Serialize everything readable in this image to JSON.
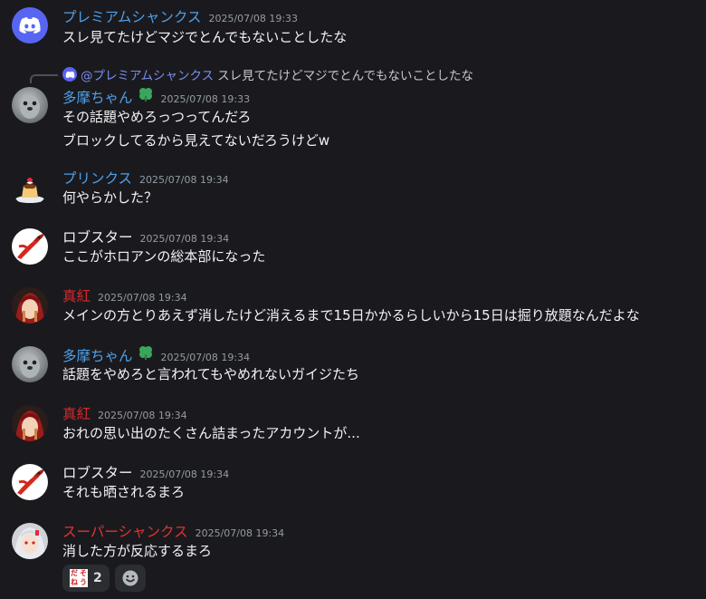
{
  "messages": [
    {
      "author": "プレミアムシャンクス",
      "color": "#4fa0e8",
      "time": "2025/07/08 19:33",
      "lines": [
        "スレ見てたけどマジでとんでもないことしたな"
      ],
      "avatar": "discord-logo"
    },
    {
      "author": "多摩ちゃん",
      "color": "#4fa0e8",
      "time": "2025/07/08 19:33",
      "lines": [
        "その話題やめろっつってんだろ",
        "ブロックしてるから見えてないだろうけどw"
      ],
      "avatar": "seal-photo",
      "badge": "clover"
    },
    {
      "author": "プリンクス",
      "color": "#4fa0e8",
      "time": "2025/07/08 19:34",
      "lines": [
        "何やらかした？"
      ],
      "avatar": "pudding"
    },
    {
      "author": "ロブスター",
      "color": "#f2f3f5",
      "time": "2025/07/08 19:34",
      "lines": [
        "ここがホロアンの総本部になった"
      ],
      "avatar": "lobster"
    },
    {
      "author": "真紅",
      "color": "#d8262a",
      "time": "2025/07/08 19:34",
      "lines": [
        "メインの方とりあえず消したけど消えるまで15日かかるらしいから15日は掘り放題なんだよな"
      ],
      "avatar": "anime-red"
    },
    {
      "author": "多摩ちゃん",
      "color": "#4fa0e8",
      "time": "2025/07/08 19:34",
      "lines": [
        "話題をやめろと言われてもやめれないガイジたち"
      ],
      "avatar": "seal-photo",
      "badge": "clover"
    },
    {
      "author": "真紅",
      "color": "#d8262a",
      "time": "2025/07/08 19:34",
      "lines": [
        "おれの思い出のたくさん詰まったアカウントが..."
      ],
      "avatar": "anime-red"
    },
    {
      "author": "ロブスター",
      "color": "#f2f3f5",
      "time": "2025/07/08 19:34",
      "lines": [
        "それも晒されるまろ"
      ],
      "avatar": "lobster"
    },
    {
      "author": "スーパーシャンクス",
      "color": "#e2332f",
      "time": "2025/07/08 19:34",
      "lines": [
        "消した方が反応するまろ"
      ],
      "avatar": "anime-white"
    }
  ],
  "reply": {
    "mention": "@プレミアムシャンクス",
    "text": "スレ見てたけどマジでとんでもないことしたな"
  },
  "reaction": {
    "emoji_chars": [
      "だ",
      "そ",
      "ね",
      "う"
    ],
    "count": "2",
    "add_icon": "smile-icon"
  }
}
